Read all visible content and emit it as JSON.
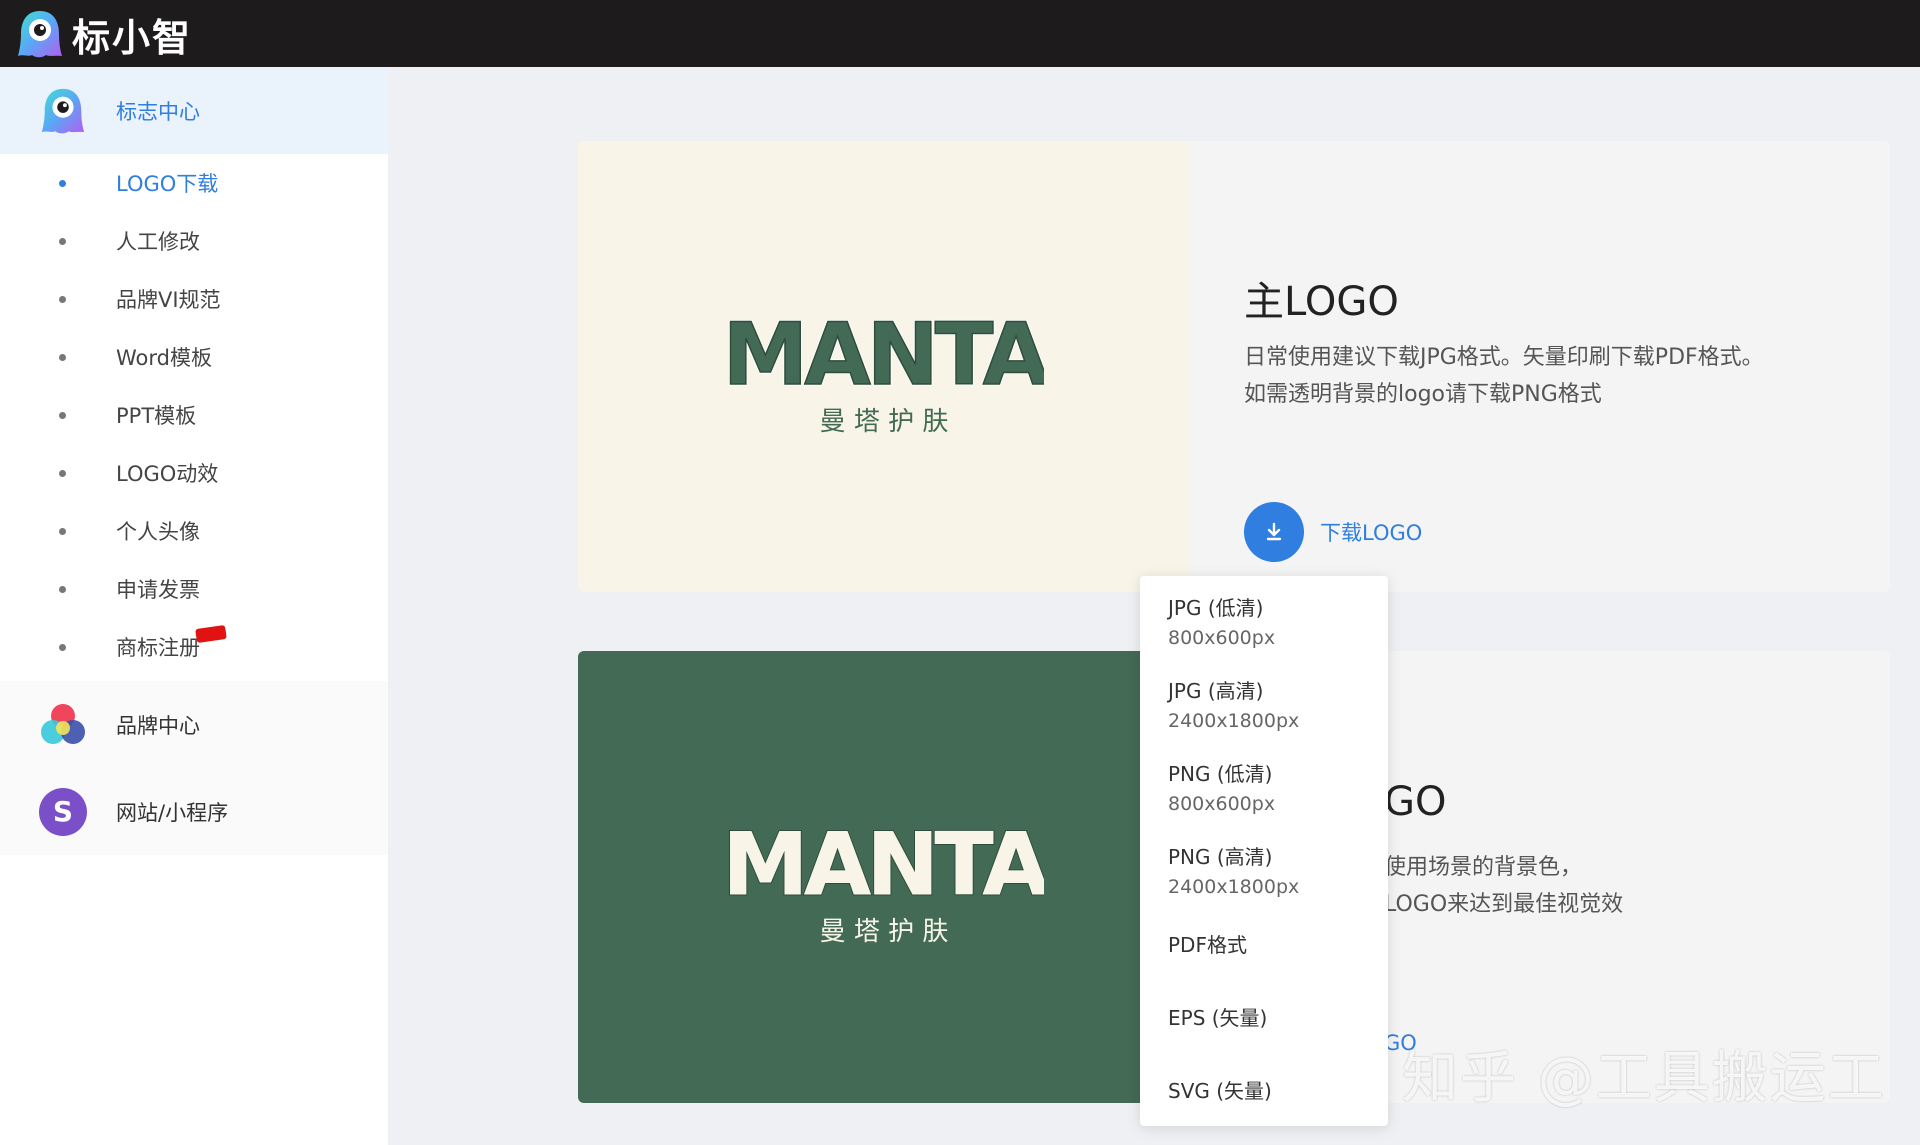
{
  "app": {
    "brand_name": "标小智"
  },
  "sidebar": {
    "groups": [
      {
        "label": "标志中心",
        "icon": "mascot-icon"
      },
      {
        "label": "品牌中心",
        "icon": "color-circles-icon"
      },
      {
        "label": "网站/小程序",
        "icon": "s-letter-icon"
      }
    ],
    "items": [
      {
        "label": "LOGO下载"
      },
      {
        "label": "人工修改"
      },
      {
        "label": "品牌VI规范"
      },
      {
        "label": "Word模板"
      },
      {
        "label": "PPT模板"
      },
      {
        "label": "LOGO动效"
      },
      {
        "label": "个人头像"
      },
      {
        "label": "申请发票"
      },
      {
        "label": "商标注册"
      }
    ]
  },
  "logo": {
    "name_en": "MANTA",
    "name_cn": "曼 塔 护 肤"
  },
  "cards": [
    {
      "title": "主LOGO",
      "desc_line1": "日常使用建议下载JPG格式。矢量印刷下载PDF格式。",
      "desc_line2": "如需透明背景的logo请下载PNG格式",
      "download_label": "下载LOGO"
    },
    {
      "title_partial": "GO",
      "desc_line1_partial": "使用场景的背景色，",
      "desc_line2_partial": "LOGO来达到最佳视觉效",
      "download_label_partial": "GO"
    }
  ],
  "dropdown": {
    "items": [
      {
        "main": "JPG (低清)",
        "sub": "800x600px"
      },
      {
        "main": "JPG (高清)",
        "sub": "2400x1800px"
      },
      {
        "main": "PNG (低清)",
        "sub": "800x600px"
      },
      {
        "main": "PNG (高清)",
        "sub": "2400x1800px"
      },
      {
        "main": "PDF格式",
        "sub": ""
      },
      {
        "main": "EPS (矢量)",
        "sub": ""
      },
      {
        "main": "SVG (矢量)",
        "sub": ""
      }
    ]
  },
  "watermark": "知乎 @工具搬运工",
  "colors": {
    "accent": "#2f7ee0",
    "logo_green": "#436a55",
    "logo_cream": "#f8f5e8",
    "topbar": "#1e1b1c"
  }
}
